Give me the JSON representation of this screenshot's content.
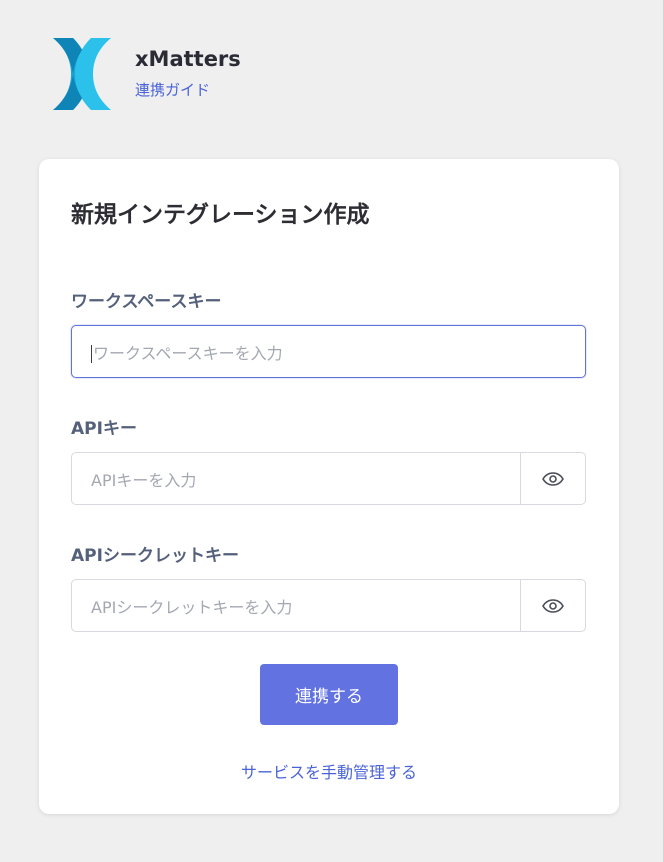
{
  "header": {
    "app_name": "xMatters",
    "subtitle_link": "連携ガイド",
    "logo_icon": "xmatters-logo-icon",
    "logo_colors": [
      "#1aa7d8",
      "#2bc1ea",
      "#0e7fb2"
    ]
  },
  "form": {
    "title": "新規インテグレーション作成",
    "workspace_key": {
      "label": "ワークスペースキー",
      "placeholder": "ワークスペースキーを入力",
      "value": ""
    },
    "api_key": {
      "label": "APIキー",
      "placeholder": "APIキーを入力",
      "value": "",
      "toggle_icon": "eye-icon"
    },
    "api_secret": {
      "label": "APIシークレットキー",
      "placeholder": "APIシークレットキーを入力",
      "value": "",
      "toggle_icon": "eye-icon"
    },
    "submit_label": "連携する",
    "manual_link": "サービスを手動管理する"
  },
  "colors": {
    "accent": "#6273e1",
    "link": "#4a63d6",
    "label": "#55607b",
    "background": "#efeff0"
  }
}
